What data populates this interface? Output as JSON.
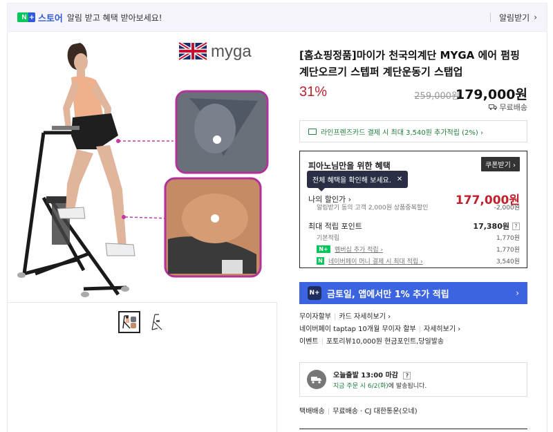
{
  "topbar": {
    "badge_n": "N",
    "badge_plus": "+",
    "store_label": "스토어",
    "notice": "알림 받고 혜택 받아보세요!",
    "alarm_label": "알림받기",
    "chevron": "›"
  },
  "image": {
    "brand": "myga",
    "thumb_count": 2
  },
  "product": {
    "title": "[홈쇼핑정품]마이가 천국의계단 MYGA 에어 펌핑 계단오르기 스텝퍼 계단운동기 스탭업",
    "discount": "31%",
    "original_price": "259,000원",
    "sale_price": "179,000원",
    "shipping": "무료배송"
  },
  "card_promo": {
    "text": "라인프렌즈카드 결제 시 최대 3,540원 추가적립 (2%) ›"
  },
  "benefits": {
    "title": "피아노님만을 위한 혜택",
    "coupon_button": "쿠폰받기 ›",
    "tooltip": "전체 혜택을 확인해 보세요.",
    "tooltip_close": "✕",
    "my_discount_label": "나의 할인가 ›",
    "my_discount_price": "177,000원",
    "sub_discount_label": "알림받기 동의 고객 2,000원 상품중복할인",
    "sub_discount_value": "-2,000원",
    "max_points_label": "최대 적립 포인트",
    "max_points_value": "17,380원",
    "qmark": "?",
    "basic_label": "기본적립",
    "basic_value": "1,770원",
    "member_label": "멤버십 추가 적립 ›",
    "member_value": "1,770원",
    "pay_label": "네이버페이 머니 결제 시 최대 적립 ›",
    "pay_value": "3,540원"
  },
  "banner": {
    "badge": "N+",
    "text": "금토일, 앱에서만 1% 추가 적립",
    "arrow": "›"
  },
  "info": {
    "line1_a": "무이자할부",
    "line1_b": "카드 자세히보기 ›",
    "line2_a": "네이버페이 taptap 10개월 무이자 할부",
    "line2_b": "자세히보기 ›",
    "line3_a": "이벤트",
    "line3_b": "포토리뷰10,000원 현금포인트,당일발송"
  },
  "delivery": {
    "title": "오늘출발 13:00 마감",
    "qmark": "?",
    "order_now": "지금 주문 시 6/2(화)",
    "order_rest": "에 발송됩니다."
  },
  "shipping_info": {
    "label": "택배배송",
    "value": "무료배송 · CJ 대한통운(오네)"
  },
  "colors": {
    "accent_green": "#03c75a",
    "accent_blue": "#3c64e0",
    "discount_red": "#c11f2b"
  }
}
